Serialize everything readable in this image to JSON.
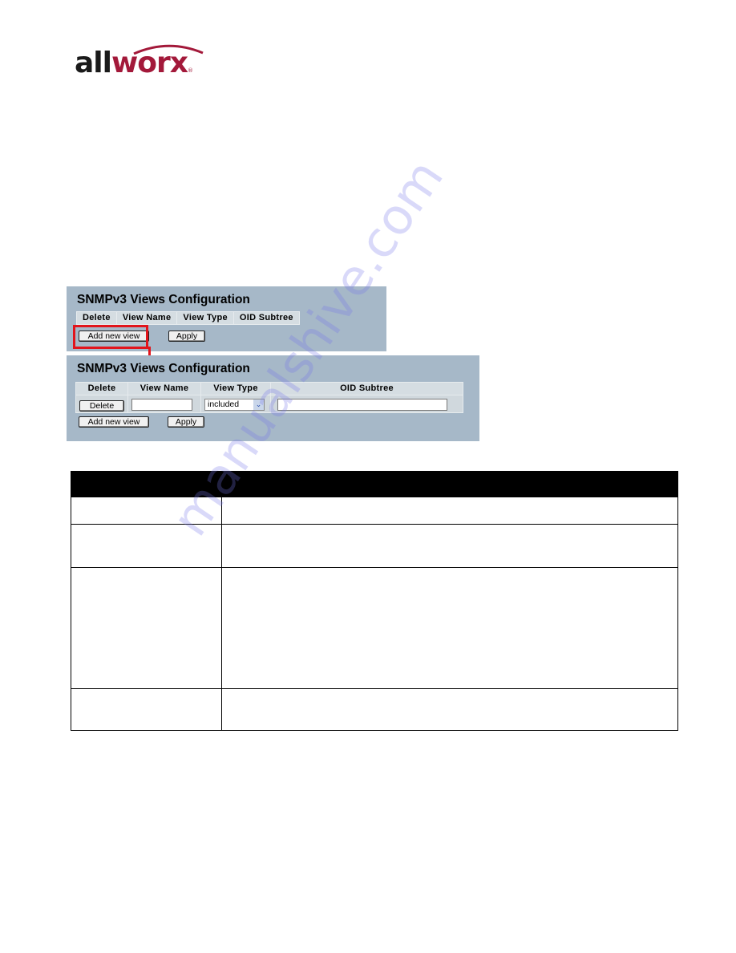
{
  "logo": {
    "part1": "all",
    "part2": "worx",
    "registered": "®",
    "colors": {
      "dark": "#1a1a1a",
      "accent": "#a3193a"
    }
  },
  "panel_before": {
    "title": "SNMPv3 Views Configuration",
    "columns": [
      "Delete",
      "View Name",
      "View Type",
      "OID Subtree"
    ],
    "buttons": {
      "add_new_view": "Add new view",
      "apply": "Apply"
    }
  },
  "panel_after": {
    "title": "SNMPv3 Views Configuration",
    "columns": [
      "Delete",
      "View Name",
      "View Type",
      "OID Subtree"
    ],
    "row": {
      "delete_label": "Delete",
      "view_name_value": "",
      "view_type_selected": "included",
      "oid_subtree_value": ""
    },
    "buttons": {
      "add_new_view": "Add new view",
      "apply": "Apply"
    }
  },
  "annotation": {
    "highlight": "Add new view",
    "highlight_color": "#e2141b"
  },
  "description_table": {
    "header": [
      "",
      ""
    ],
    "rows": [
      [
        "",
        ""
      ],
      [
        "",
        ""
      ],
      [
        "",
        ""
      ],
      [
        "",
        ""
      ]
    ]
  },
  "watermark": "manualshive.com"
}
